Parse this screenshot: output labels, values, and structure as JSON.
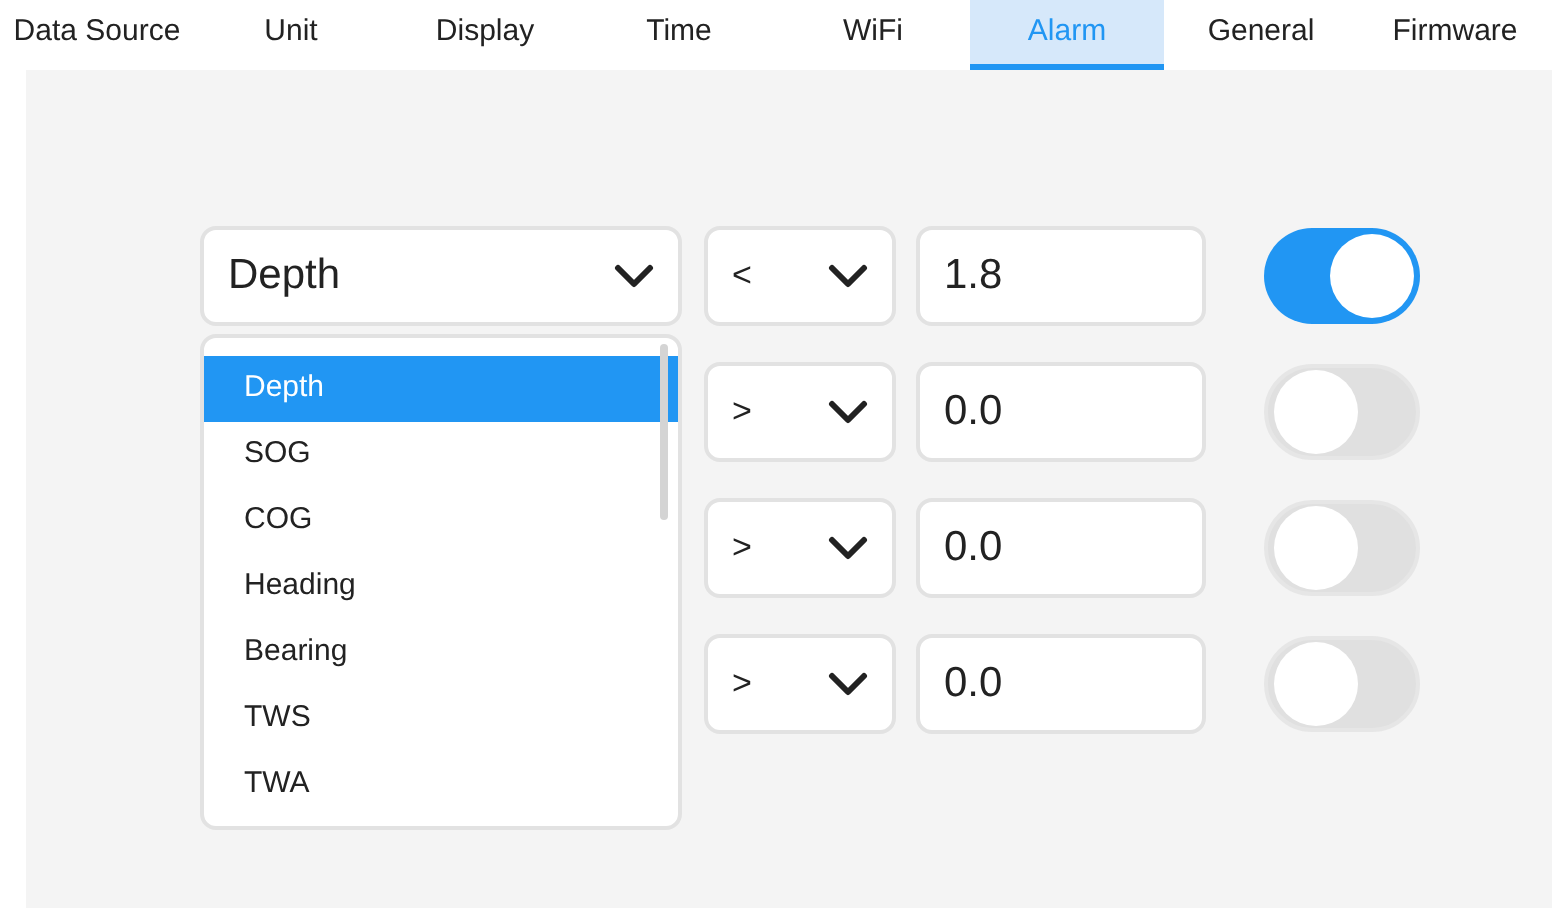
{
  "tabs": [
    {
      "label": "Data Source",
      "selected": false
    },
    {
      "label": "Unit",
      "selected": false
    },
    {
      "label": "Display",
      "selected": false
    },
    {
      "label": "Time",
      "selected": false
    },
    {
      "label": "WiFi",
      "selected": false
    },
    {
      "label": "Alarm",
      "selected": true
    },
    {
      "label": "General",
      "selected": false
    },
    {
      "label": "Firmware",
      "selected": false
    }
  ],
  "alarms": [
    {
      "source": "Depth",
      "operator": "<",
      "value": "1.8",
      "on": true
    },
    {
      "operator": ">",
      "value": "0.0",
      "on": false
    },
    {
      "operator": ">",
      "value": "0.0",
      "on": false
    },
    {
      "operator": ">",
      "value": "0.0",
      "on": false
    }
  ],
  "source_list": [
    {
      "label": "Depth",
      "selected": true
    },
    {
      "label": "SOG",
      "selected": false
    },
    {
      "label": "COG",
      "selected": false
    },
    {
      "label": "Heading",
      "selected": false
    },
    {
      "label": "Bearing",
      "selected": false
    },
    {
      "label": "TWS",
      "selected": false
    },
    {
      "label": "TWA",
      "selected": false
    }
  ]
}
